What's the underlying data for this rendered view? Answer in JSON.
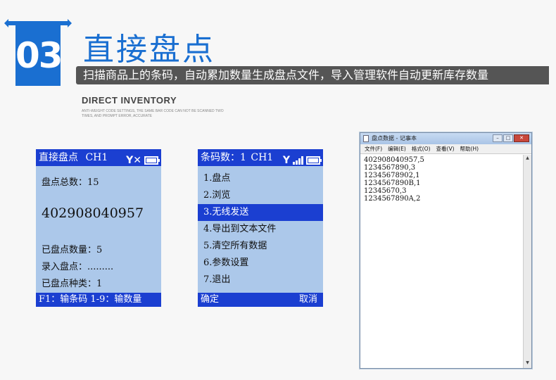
{
  "header": {
    "number": "03",
    "title": "直接盘点",
    "subtitle": "扫描商品上的条码，自动累加数量生成盘点文件，导入管理软件自动更新库存数量",
    "en_title": "DIRECT INVENTORY",
    "en_desc": "ANTI-WEIGHT CODE SETTINGS, THE SAME BAR CODE CAN NOT BE SCANNED TWO TIMES, AND PROMPT ERROR, ACCURATE"
  },
  "screen1": {
    "title": "直接盘点",
    "channel": "CH1",
    "total_label": "盘点总数：15",
    "barcode": "402908040957",
    "count_label": "已盘点数量：5",
    "input_label": "录入盘点：.........",
    "kinds_label": "已盘点种类：1",
    "footer": "F1：输条码  1-9：输数量"
  },
  "screen2": {
    "title": "条码数：1",
    "channel": "CH1",
    "menu": [
      "1.盘点",
      "2.浏览",
      "3.无线发送",
      "4.导出到文本文件",
      "5.清空所有数据",
      "6.参数设置",
      "7.退出"
    ],
    "selected_index": 2,
    "footer_left": "确定",
    "footer_right": "取消"
  },
  "notepad": {
    "title": "盘点数据 - 记事本",
    "menu": [
      "文件(F)",
      "编辑(E)",
      "格式(O)",
      "查看(V)",
      "帮助(H)"
    ],
    "lines": [
      "402908040957,5",
      "1234567890,3",
      "12345678902,1",
      "1234567890B,1",
      "12345670,3",
      "1234567890A,2"
    ]
  }
}
